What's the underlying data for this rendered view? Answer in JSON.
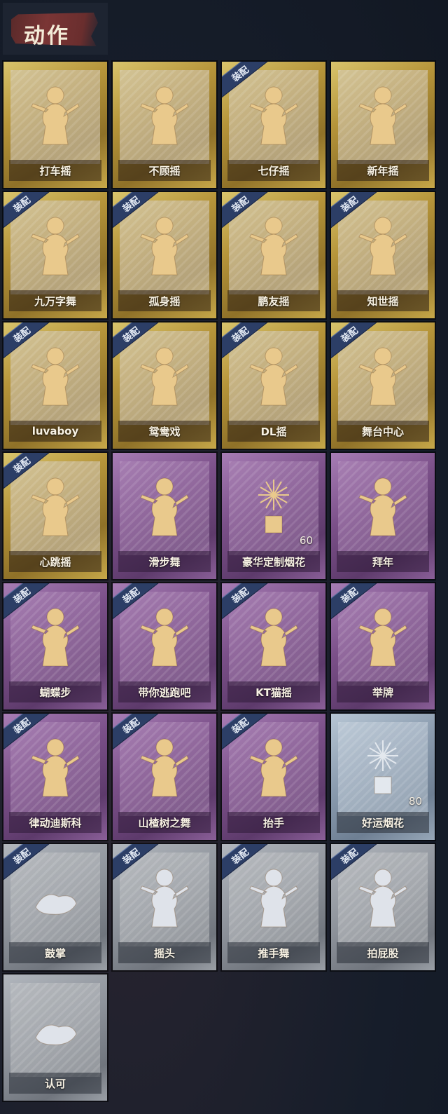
{
  "header": {
    "title": "动作"
  },
  "badge_label": "装配",
  "items": [
    {
      "label": "打车摇",
      "tier": "gold",
      "equipped": false,
      "icon": "dance-pose-icon",
      "qty": ""
    },
    {
      "label": "不顾摇",
      "tier": "gold",
      "equipped": false,
      "icon": "dance-pose-icon",
      "qty": ""
    },
    {
      "label": "七仔摇",
      "tier": "gold",
      "equipped": true,
      "icon": "dance-pose-icon",
      "qty": ""
    },
    {
      "label": "新年摇",
      "tier": "gold",
      "equipped": false,
      "icon": "dance-pose-icon",
      "qty": ""
    },
    {
      "label": "九万字舞",
      "tier": "gold",
      "equipped": true,
      "icon": "dance-pose-icon",
      "qty": ""
    },
    {
      "label": "孤身摇",
      "tier": "gold",
      "equipped": true,
      "icon": "dance-pose-icon",
      "qty": ""
    },
    {
      "label": "鹏友摇",
      "tier": "gold",
      "equipped": true,
      "icon": "dance-pose-icon",
      "qty": ""
    },
    {
      "label": "知世摇",
      "tier": "gold",
      "equipped": true,
      "icon": "dance-pose-icon",
      "qty": ""
    },
    {
      "label": "luvaboy",
      "tier": "gold",
      "equipped": true,
      "icon": "dance-pose-icon",
      "qty": ""
    },
    {
      "label": "鸳鸯戏",
      "tier": "gold",
      "equipped": true,
      "icon": "dance-pose-icon",
      "qty": ""
    },
    {
      "label": "DL摇",
      "tier": "gold",
      "equipped": true,
      "icon": "dance-pose-icon",
      "qty": ""
    },
    {
      "label": "舞台中心",
      "tier": "gold",
      "equipped": true,
      "icon": "dance-pose-icon",
      "qty": ""
    },
    {
      "label": "心跳摇",
      "tier": "gold",
      "equipped": true,
      "icon": "dance-pose-icon",
      "qty": ""
    },
    {
      "label": "滑步舞",
      "tier": "purple",
      "equipped": false,
      "icon": "dance-pose-icon",
      "qty": ""
    },
    {
      "label": "豪华定制烟花",
      "tier": "purple",
      "equipped": false,
      "icon": "firework-box-icon",
      "qty": "60"
    },
    {
      "label": "拜年",
      "tier": "purple",
      "equipped": false,
      "icon": "bow-greeting-icon",
      "qty": ""
    },
    {
      "label": "蝴蝶步",
      "tier": "purple",
      "equipped": true,
      "icon": "dance-pose-icon",
      "qty": ""
    },
    {
      "label": "带你逃跑吧",
      "tier": "purple",
      "equipped": true,
      "icon": "dance-pose-icon",
      "qty": ""
    },
    {
      "label": "KT猫摇",
      "tier": "purple",
      "equipped": true,
      "icon": "dance-pose-icon",
      "qty": ""
    },
    {
      "label": "举牌",
      "tier": "purple",
      "equipped": true,
      "icon": "hold-sign-icon",
      "qty": ""
    },
    {
      "label": "律动迪斯科",
      "tier": "purple",
      "equipped": true,
      "icon": "dance-pose-icon",
      "qty": ""
    },
    {
      "label": "山楂树之舞",
      "tier": "purple",
      "equipped": true,
      "icon": "dance-pose-icon",
      "qty": ""
    },
    {
      "label": "抬手",
      "tier": "purple",
      "equipped": true,
      "icon": "raise-hand-icon",
      "qty": ""
    },
    {
      "label": "好运烟花",
      "tier": "blue",
      "equipped": false,
      "icon": "firework-tube-icon",
      "qty": "80"
    },
    {
      "label": "鼓掌",
      "tier": "grey",
      "equipped": true,
      "icon": "clap-icon",
      "qty": ""
    },
    {
      "label": "摇头",
      "tier": "grey",
      "equipped": true,
      "icon": "shake-head-icon",
      "qty": ""
    },
    {
      "label": "推手舞",
      "tier": "grey",
      "equipped": true,
      "icon": "push-hands-icon",
      "qty": ""
    },
    {
      "label": "拍屁股",
      "tier": "grey",
      "equipped": true,
      "icon": "slap-icon",
      "qty": ""
    },
    {
      "label": "认可",
      "tier": "grey",
      "equipped": false,
      "icon": "thumbs-up-icon",
      "qty": ""
    }
  ]
}
